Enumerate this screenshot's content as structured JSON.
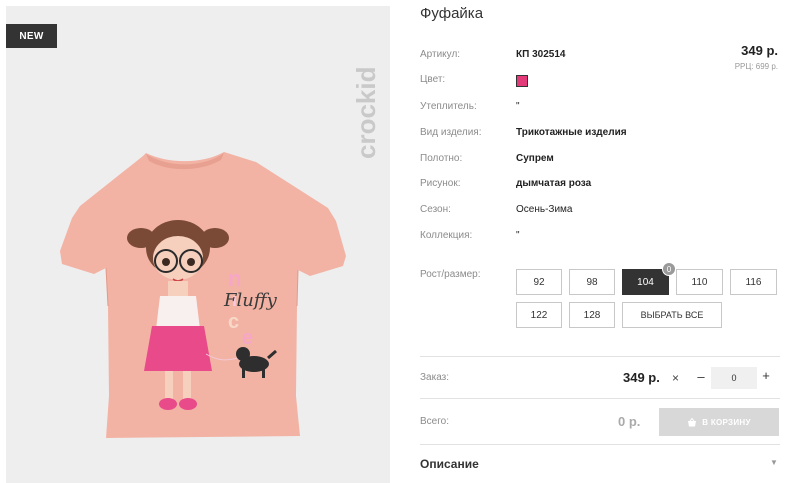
{
  "product": {
    "title": "Фуфайка",
    "badge": "NEW",
    "brand_logo": "crockid",
    "price": "349 р.",
    "rrp": "РРЦ: 699 р.",
    "specs": [
      {
        "label": "Артикул:",
        "value": "КП 302514"
      },
      {
        "label": "Цвет:",
        "value": ""
      },
      {
        "label": "Утеплитель:",
        "value": "\""
      },
      {
        "label": "Вид изделия:",
        "value": "Трикотажные изделия"
      },
      {
        "label": "Полотно:",
        "value": "Супрем"
      },
      {
        "label": "Рисунок:",
        "value": "дымчатая роза"
      },
      {
        "label": "Сезон:",
        "value": "Осень-Зима"
      },
      {
        "label": "Коллекция:",
        "value": "\""
      }
    ],
    "color_hex": "#e33b7a",
    "print_text": "Fluffy"
  },
  "sizes": {
    "label": "Рост/размер:",
    "options": [
      "92",
      "98",
      "104",
      "110",
      "116",
      "122",
      "128"
    ],
    "selected": "104",
    "selected_count": "0",
    "select_all": "ВЫБРАТЬ ВСЕ"
  },
  "order": {
    "label": "Заказ:",
    "price": "349 р.",
    "multiply_icon": "×",
    "minus": "–",
    "quantity": "0",
    "plus": "+"
  },
  "total": {
    "label": "Всего:",
    "value": "0 р.",
    "cart_button": "В КОРЗИНУ",
    "cart_icon": "basket-icon"
  },
  "description": {
    "title": "Описание",
    "chevron": "▼"
  },
  "colors": {
    "badge_bg": "#333333",
    "shirt": "#f2b3a4",
    "active_size": "#333333",
    "cart_disabled": "#d8d8d8"
  }
}
